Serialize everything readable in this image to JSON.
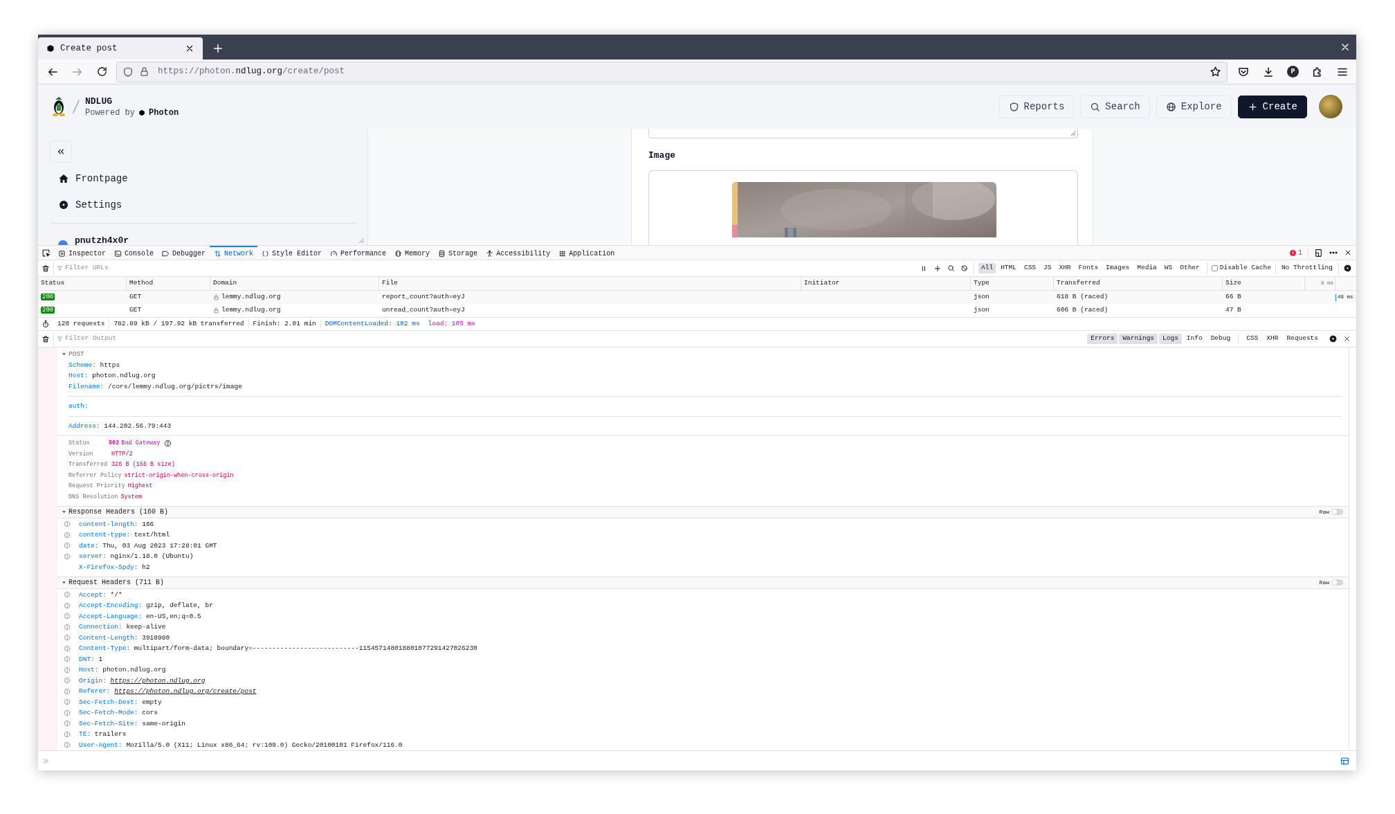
{
  "browser": {
    "tab": {
      "title": "Create post"
    },
    "url": {
      "scheme": "https://",
      "host_prefix": "photon.",
      "host": "ndlug.org",
      "path": "/create/post"
    },
    "account_initial": "P"
  },
  "site": {
    "name": "NDLUG",
    "powered_by": "Powered by",
    "platform": "Photon",
    "header_buttons": [
      {
        "label": "Reports",
        "kind": "outline"
      },
      {
        "label": "Search",
        "kind": "outline"
      },
      {
        "label": "Explore",
        "kind": "outline"
      },
      {
        "label": "Create",
        "kind": "primary"
      }
    ]
  },
  "sidebar": {
    "items": [
      {
        "label": "Frontpage"
      },
      {
        "label": "Settings"
      }
    ],
    "user": "pnutzh4x0r"
  },
  "form": {
    "image_label": "Image"
  },
  "devtools": {
    "tabs": [
      {
        "label": "Inspector",
        "selected": false
      },
      {
        "label": "Console",
        "selected": false
      },
      {
        "label": "Debugger",
        "selected": false
      },
      {
        "label": "Network",
        "selected": true
      },
      {
        "label": "Style Editor",
        "selected": false
      },
      {
        "label": "Performance",
        "selected": false
      },
      {
        "label": "Memory",
        "selected": false
      },
      {
        "label": "Storage",
        "selected": false
      },
      {
        "label": "Accessibility",
        "selected": false
      },
      {
        "label": "Application",
        "selected": false
      }
    ],
    "error_count": "1",
    "network": {
      "filter_placeholder": "Filter URLs",
      "type_filters": [
        {
          "label": "All",
          "selected": true
        },
        {
          "label": "HTML",
          "selected": false
        },
        {
          "label": "CSS",
          "selected": false
        },
        {
          "label": "JS",
          "selected": false
        },
        {
          "label": "XHR",
          "selected": false
        },
        {
          "label": "Fonts",
          "selected": false
        },
        {
          "label": "Images",
          "selected": false
        },
        {
          "label": "Media",
          "selected": false
        },
        {
          "label": "WS",
          "selected": false
        },
        {
          "label": "Other",
          "selected": false
        }
      ],
      "disable_cache": {
        "label": "Disable Cache",
        "checked": false
      },
      "throttling": "No Throttling",
      "columns": [
        "Status",
        "Method",
        "Domain",
        "File",
        "Initiator",
        "Type",
        "Transferred",
        "Size"
      ],
      "timeline_label": "8 ms",
      "rows": [
        {
          "status": "200",
          "method": "GET",
          "secure": true,
          "domain": "lemmy.ndlug.org",
          "file": "report_count?auth=eyJ",
          "type": "json",
          "transferred": "618 B (raced)",
          "size": "66 B",
          "timing": "48 ms"
        },
        {
          "status": "200",
          "method": "GET",
          "secure": true,
          "domain": "lemmy.ndlug.org",
          "file": "unread_count?auth=eyJ",
          "type": "json",
          "transferred": "606 B (raced)",
          "size": "47 B"
        }
      ],
      "summary": {
        "requests": "120 requests",
        "transferred": "782.89 kB / 197.92 kB transferred",
        "finish": "Finish: 2.01 min",
        "dom_content_loaded": "DOMContentLoaded: 102 ms",
        "load": "load: 105 ms"
      }
    },
    "console": {
      "filter_placeholder": "Filter Output",
      "level_filters": [
        {
          "label": "Errors",
          "selected": true
        },
        {
          "label": "Warnings",
          "selected": true
        },
        {
          "label": "Logs",
          "selected": true
        },
        {
          "label": "Info",
          "selected": false
        },
        {
          "label": "Debug",
          "selected": false
        }
      ],
      "type_filters": [
        {
          "label": "CSS",
          "selected": false
        },
        {
          "label": "XHR",
          "selected": false
        },
        {
          "label": "Requests",
          "selected": false
        }
      ],
      "request": {
        "method": "POST",
        "expanded": true,
        "url_fields": [
          {
            "key": "Scheme:",
            "value": "https"
          },
          {
            "key": "Host:",
            "value": "photon.ndlug.org"
          },
          {
            "key": "Filename:",
            "value": "/cors/lemmy.ndlug.org/pictrs/image"
          }
        ],
        "params": [
          {
            "key": "auth:"
          }
        ],
        "remote": [
          {
            "key": "Address:",
            "value": "144.202.56.79:443"
          }
        ],
        "status": {
          "label": "Status",
          "code": "502",
          "text": "Bad Gateway"
        },
        "details": [
          {
            "label": "Version",
            "value": "HTTP/2"
          },
          {
            "label": "Transferred",
            "value": "326 B (166 B size)"
          },
          {
            "label": "Referrer Policy",
            "value": "strict-origin-when-cross-origin"
          },
          {
            "label": "Request Priority",
            "value": "Highest"
          },
          {
            "label": "DNS Resolution",
            "value": "System"
          }
        ],
        "header_groups": [
          {
            "title": "Response Headers (160 B)",
            "expanded": true,
            "raw": {
              "label": "Raw",
              "on": false
            },
            "headers": [
              {
                "name": "content-length:",
                "value": "166",
                "help": true
              },
              {
                "name": "content-type:",
                "value": "text/html",
                "help": true
              },
              {
                "name": "date:",
                "value": "Thu, 03 Aug 2023 17:28:01 GMT",
                "help": true
              },
              {
                "name": "server:",
                "value": "nginx/1.18.0 (Ubuntu)",
                "help": true
              },
              {
                "name": "X-Firefox-Spdy:",
                "value": "h2",
                "help": false
              }
            ]
          },
          {
            "title": "Request Headers (711 B)",
            "expanded": true,
            "raw": {
              "label": "Raw",
              "on": false
            },
            "headers": [
              {
                "name": "Accept:",
                "value": "*/*",
                "help": true
              },
              {
                "name": "Accept-Encoding:",
                "value": "gzip, deflate, br",
                "help": true
              },
              {
                "name": "Accept-Language:",
                "value": "en-US,en;q=0.5",
                "help": true
              },
              {
                "name": "Connection:",
                "value": "keep-alive",
                "help": true
              },
              {
                "name": "Content-Length:",
                "value": "3918980",
                "help": true
              },
              {
                "name": "Content-Type:",
                "value": "multipart/form-data; boundary=---------------------------115457148018801077291427026230",
                "help": true
              },
              {
                "name": "DNT:",
                "value": "1",
                "help": true
              },
              {
                "name": "Host:",
                "value": "photon.ndlug.org",
                "help": true
              },
              {
                "name": "Origin:",
                "value": "https://photon.ndlug.org",
                "help": true,
                "link": true
              },
              {
                "name": "Referer:",
                "value": "https://photon.ndlug.org/create/post",
                "help": true,
                "link": true
              },
              {
                "name": "Sec-Fetch-Dest:",
                "value": "empty",
                "help": true
              },
              {
                "name": "Sec-Fetch-Mode:",
                "value": "cors",
                "help": true
              },
              {
                "name": "Sec-Fetch-Site:",
                "value": "same-origin",
                "help": true
              },
              {
                "name": "TE:",
                "value": "trailers",
                "help": true
              },
              {
                "name": "User-Agent:",
                "value": "Mozilla/5.0 (X11; Linux x86_64; rv:109.0) Gecko/20100101 Firefox/116.0",
                "help": true
              }
            ]
          }
        ]
      }
    }
  }
}
